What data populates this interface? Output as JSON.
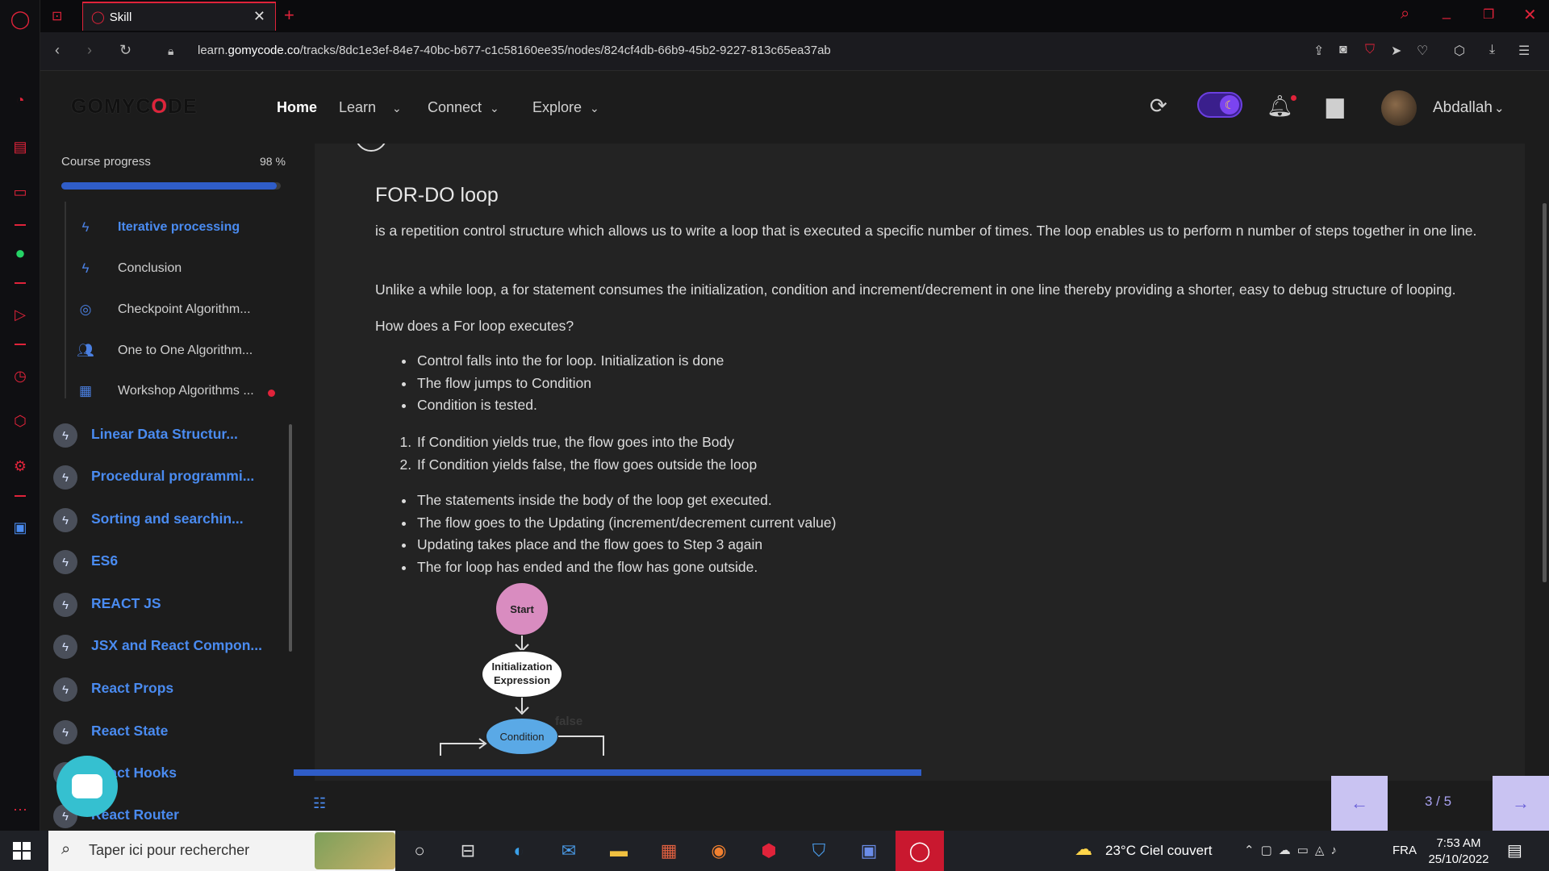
{
  "browser": {
    "tab_title": "Skill",
    "url_prefix": "learn.",
    "url_domain": "gomycode.co",
    "url_path": "/tracks/8dc1e3ef-84e7-40bc-b677-c1c58160ee35/nodes/824cf4db-66b9-45b2-9227-813c65ea37ab"
  },
  "header": {
    "logo_a": "GOMYC",
    "logo_o": "O",
    "logo_b": "DE",
    "nav": [
      {
        "label": "Home"
      },
      {
        "label": "Learn"
      },
      {
        "label": "Connect"
      },
      {
        "label": "Explore"
      }
    ],
    "username": "Abdallah"
  },
  "sidebar": {
    "progress_label": "Course progress",
    "progress_value": "98 %",
    "progress_fraction": 0.98,
    "sub_items": [
      {
        "label": "Iterative processing",
        "icon": "bolt-icon",
        "highlight": true
      },
      {
        "label": "Conclusion",
        "icon": "bolt-icon"
      },
      {
        "label": "Checkpoint Algorithm...",
        "icon": "target-icon"
      },
      {
        "label": "One to One Algorithm...",
        "icon": "people-icon"
      },
      {
        "label": "Workshop Algorithms ...",
        "icon": "workshop-icon",
        "dot": true
      }
    ],
    "modules": [
      {
        "label": "Linear Data Structur..."
      },
      {
        "label": "Procedural programmi..."
      },
      {
        "label": "Sorting and searchin..."
      },
      {
        "label": "ES6"
      },
      {
        "label": "REACT JS"
      },
      {
        "label": "JSX and React Compon..."
      },
      {
        "label": "React Props"
      },
      {
        "label": "React State"
      },
      {
        "label": "React Hooks"
      },
      {
        "label": "React Router"
      }
    ]
  },
  "lesson": {
    "title": "FOR-DO loop",
    "p1": "is a repetition control structure which allows us to write a loop that is executed a specific number of times. The loop enables us to perform n number of steps together in one line.",
    "p2": "Unlike a while loop, a for statement consumes the initialization, condition and increment/decrement in one line thereby providing a shorter, easy to debug structure of looping.",
    "p3": "How does a For loop executes?",
    "list1": [
      "Control falls into the for loop. Initialization is done",
      "The flow jumps to Condition",
      "Condition is tested."
    ],
    "list2": [
      "If Condition yields true, the flow goes into the Body",
      "If Condition yields false, the flow goes outside the loop"
    ],
    "list3": [
      "The statements inside the body of the loop get executed.",
      "The flow goes to the Updating (increment/decrement current value)",
      "Updating takes place and the flow goes to Step 3 again",
      "The for loop has ended and the flow has gone outside."
    ],
    "diagram": {
      "start": "Start",
      "init_line1": "Initialization",
      "init_line2": "Expression",
      "condition": "Condition",
      "false_label": "false"
    },
    "page_indicator": "3 / 5",
    "slides_progress_fraction": 0.5
  },
  "taskbar": {
    "search_placeholder": "Taper ici pour rechercher",
    "weather": "23°C  Ciel couvert",
    "language": "FRA",
    "time": "7:53 AM",
    "date": "25/10/2022"
  },
  "colors": {
    "accent_blue": "#4a8bf0",
    "progress_blue": "#2f5dc8",
    "opera_red": "#e0233a",
    "nav_button_bg": "#c9c3f2"
  }
}
